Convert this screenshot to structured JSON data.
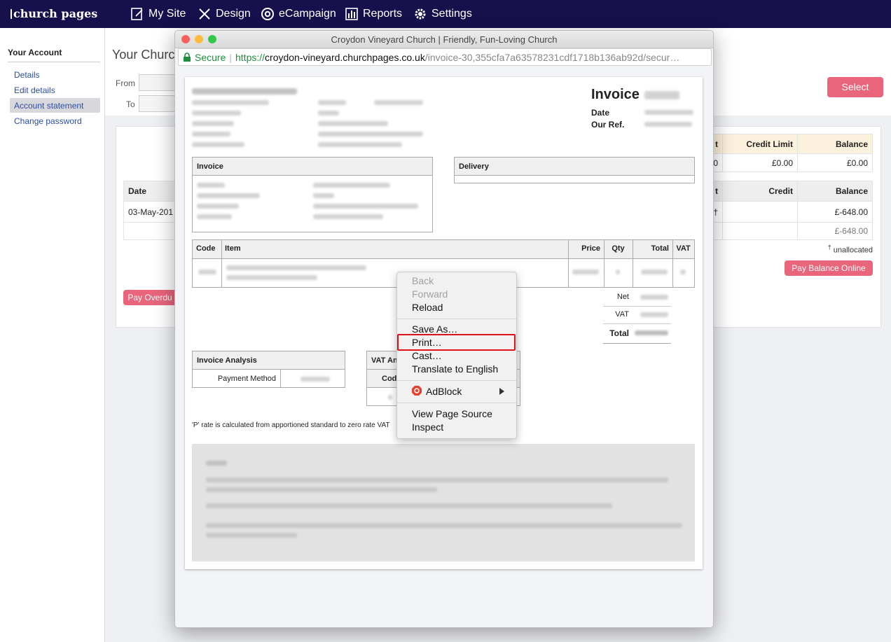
{
  "app": {
    "logo": "church pages",
    "nav": [
      {
        "label": "My Site",
        "icon": "edit-icon"
      },
      {
        "label": "Design",
        "icon": "design-tools-icon"
      },
      {
        "label": "eCampaign",
        "icon": "at-sign-icon"
      },
      {
        "label": "Reports",
        "icon": "bar-chart-icon"
      },
      {
        "label": "Settings",
        "icon": "gear-icon"
      }
    ]
  },
  "sidebar": {
    "title": "Your Account",
    "items": [
      {
        "label": "Details"
      },
      {
        "label": "Edit details"
      },
      {
        "label": "Account statement",
        "active": true
      },
      {
        "label": "Change password"
      }
    ]
  },
  "main": {
    "title": "Your Churc",
    "from_label": "From",
    "to_label": "To",
    "select_button": "Select",
    "summary_headers": [
      "t",
      "Credit Limit",
      "Balance"
    ],
    "summary_values": [
      "0",
      "£0.00",
      "£0.00"
    ],
    "table_headers": {
      "date": "Date",
      "t": "t",
      "credit": "Credit",
      "balance": "Balance"
    },
    "rows": [
      {
        "date": "03-May-201",
        "mark": "†",
        "balance": "£-648.00"
      },
      {
        "date": "",
        "mark": "",
        "balance": "£-648.00"
      }
    ],
    "unallocated_mark": "†",
    "unallocated_note": "unallocated",
    "pay_online_button": "Pay Balance Online",
    "pay_overdue_button": "Pay Overdu"
  },
  "popup": {
    "title": "Croydon Vineyard Church | Friendly, Fun-Loving Church",
    "secure_label": "Secure",
    "url_scheme": "https://",
    "url_host": "croydon-vineyard.churchpages.co.uk",
    "url_path": "/invoice-30,355cfa7a63578231cdf1718b136ab92d/secur…",
    "colors": {
      "secure": "#1e8e3e",
      "close": "#fc605c",
      "minimize": "#fdbc40",
      "zoom": "#34c84a"
    }
  },
  "invoice": {
    "title": "Invoice",
    "date_label": "Date",
    "ref_label": "Our Ref.",
    "invoice_box": "Invoice",
    "delivery_box": "Delivery",
    "items_headers": {
      "code": "Code",
      "item": "Item",
      "price": "Price",
      "qty": "Qty",
      "total": "Total",
      "vat": "VAT"
    },
    "net_label": "Net",
    "vat_label": "VAT",
    "total_label": "Total",
    "analysis_title": "Invoice Analysis",
    "payment_method_label": "Payment Method",
    "vat_analysis_title": "VAT An",
    "vat_code_header": "Cod",
    "footnote": "'P' rate is calculated from apportioned standard to zero rate VAT"
  },
  "context_menu": {
    "back": "Back",
    "forward": "Forward",
    "reload": "Reload",
    "save_as": "Save As…",
    "print": "Print…",
    "cast": "Cast…",
    "translate": "Translate to English",
    "adblock": "AdBlock",
    "view_source": "View Page Source",
    "inspect": "Inspect"
  }
}
